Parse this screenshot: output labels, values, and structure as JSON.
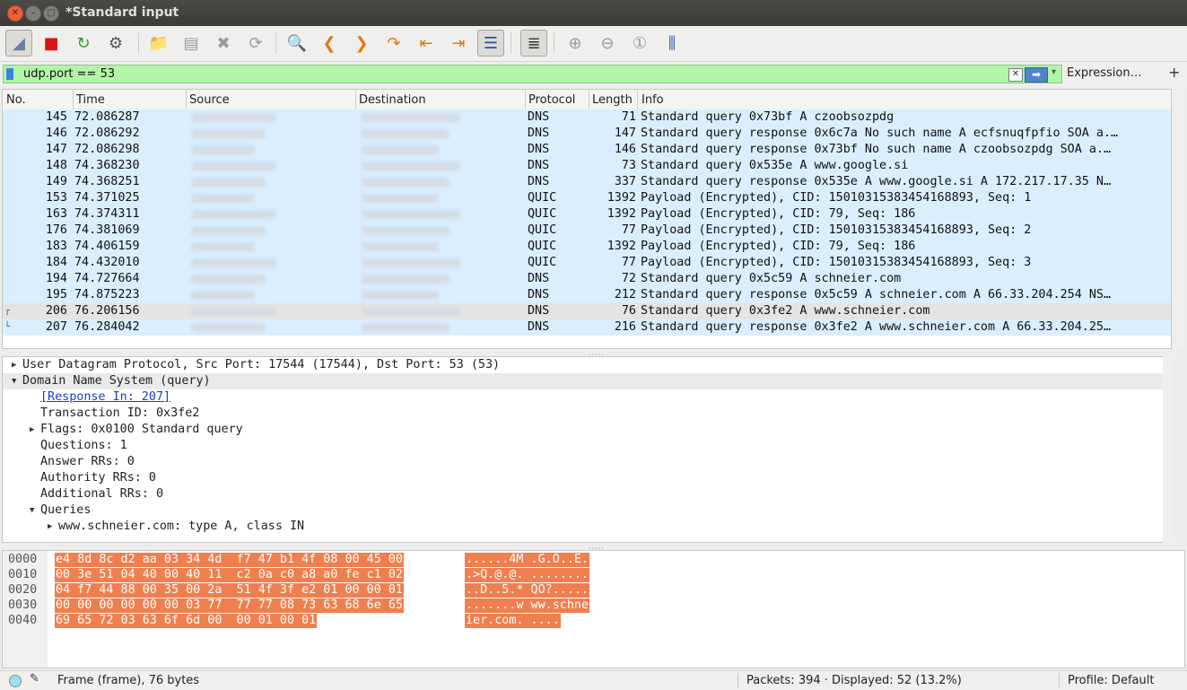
{
  "window": {
    "title": "*Standard input"
  },
  "toolbar": {
    "buttons": [
      {
        "name": "shark-fin-icon",
        "glyph": "◢"
      },
      {
        "name": "stop-capture-icon",
        "glyph": "■"
      },
      {
        "name": "restart-capture-icon",
        "glyph": "↻"
      },
      {
        "name": "capture-options-icon",
        "glyph": "⚙"
      },
      {
        "name": "open-file-icon",
        "glyph": "📁"
      },
      {
        "name": "save-file-icon",
        "glyph": "▤"
      },
      {
        "name": "close-file-icon",
        "glyph": "✖"
      },
      {
        "name": "reload-file-icon",
        "glyph": "⟳"
      },
      {
        "name": "find-packet-icon",
        "glyph": "🔍"
      },
      {
        "name": "go-back-icon",
        "glyph": "❮"
      },
      {
        "name": "go-forward-icon",
        "glyph": "❯"
      },
      {
        "name": "go-to-packet-icon",
        "glyph": "↷"
      },
      {
        "name": "first-packet-icon",
        "glyph": "⇤"
      },
      {
        "name": "last-packet-icon",
        "glyph": "⇥"
      },
      {
        "name": "auto-scroll-icon",
        "glyph": "☰"
      },
      {
        "name": "colorize-icon",
        "glyph": "≣"
      },
      {
        "name": "zoom-in-icon",
        "glyph": "⊕"
      },
      {
        "name": "zoom-out-icon",
        "glyph": "⊖"
      },
      {
        "name": "normal-size-icon",
        "glyph": "①"
      },
      {
        "name": "resize-columns-icon",
        "glyph": "⫼"
      }
    ]
  },
  "filter": {
    "value": "udp.port == 53",
    "clear_glyph": "✕",
    "apply_glyph": "➡",
    "dropdown_glyph": "▾",
    "expression_label": "Expression…",
    "add_glyph": "+"
  },
  "packet_list": {
    "columns": [
      "No.",
      "Time",
      "Source",
      "Destination",
      "Protocol",
      "Length",
      "Info"
    ],
    "rows": [
      {
        "no": "145",
        "time": "72.086287",
        "proto": "DNS",
        "len": "71",
        "info": "Standard query 0x73bf A czoobsozpdg",
        "kind": "dns"
      },
      {
        "no": "146",
        "time": "72.086292",
        "proto": "DNS",
        "len": "147",
        "info": "Standard query response 0x6c7a No such name A ecfsnuqfpfio SOA a.…",
        "kind": "dns"
      },
      {
        "no": "147",
        "time": "72.086298",
        "proto": "DNS",
        "len": "146",
        "info": "Standard query response 0x73bf No such name A czoobsozpdg SOA a.…",
        "kind": "dns"
      },
      {
        "no": "148",
        "time": "74.368230",
        "proto": "DNS",
        "len": "73",
        "info": "Standard query 0x535e A www.google.si",
        "kind": "dns"
      },
      {
        "no": "149",
        "time": "74.368251",
        "proto": "DNS",
        "len": "337",
        "info": "Standard query response 0x535e A www.google.si A 172.217.17.35 N…",
        "kind": "dns"
      },
      {
        "no": "153",
        "time": "74.371025",
        "proto": "QUIC",
        "len": "1392",
        "info": "Payload (Encrypted), CID: 15010315383454168893, Seq: 1",
        "kind": "quic"
      },
      {
        "no": "163",
        "time": "74.374311",
        "proto": "QUIC",
        "len": "1392",
        "info": "Payload (Encrypted), CID: 79, Seq: 186",
        "kind": "quic"
      },
      {
        "no": "176",
        "time": "74.381069",
        "proto": "QUIC",
        "len": "77",
        "info": "Payload (Encrypted), CID: 15010315383454168893, Seq: 2",
        "kind": "quic"
      },
      {
        "no": "183",
        "time": "74.406159",
        "proto": "QUIC",
        "len": "1392",
        "info": "Payload (Encrypted), CID: 79, Seq: 186",
        "kind": "quic"
      },
      {
        "no": "184",
        "time": "74.432010",
        "proto": "QUIC",
        "len": "77",
        "info": "Payload (Encrypted), CID: 15010315383454168893, Seq: 3",
        "kind": "quic"
      },
      {
        "no": "194",
        "time": "74.727664",
        "proto": "DNS",
        "len": "72",
        "info": "Standard query 0x5c59 A schneier.com",
        "kind": "dns"
      },
      {
        "no": "195",
        "time": "74.875223",
        "proto": "DNS",
        "len": "212",
        "info": "Standard query response 0x5c59 A schneier.com A 66.33.204.254 NS…",
        "kind": "dns"
      },
      {
        "no": "206",
        "time": "76.206156",
        "proto": "DNS",
        "len": "76",
        "info": "Standard query 0x3fe2 A www.schneier.com",
        "kind": "sel"
      },
      {
        "no": "207",
        "time": "76.284042",
        "proto": "DNS",
        "len": "216",
        "info": "Standard query response 0x3fe2 A www.schneier.com A 66.33.204.25…",
        "kind": "dns"
      }
    ]
  },
  "details": {
    "rows": [
      {
        "indent": 0,
        "arrow": "▶",
        "text": "User Datagram Protocol, Src Port: 17544 (17544), Dst Port: 53 (53)",
        "hl": false
      },
      {
        "indent": 0,
        "arrow": "▼",
        "text": "Domain Name System (query)",
        "hl": true
      },
      {
        "indent": 1,
        "arrow": "",
        "text": "[Response In: 207]",
        "hl": false,
        "link": true
      },
      {
        "indent": 1,
        "arrow": "",
        "text": "Transaction ID: 0x3fe2",
        "hl": false
      },
      {
        "indent": 1,
        "arrow": "▶",
        "text": "Flags: 0x0100 Standard query",
        "hl": false
      },
      {
        "indent": 1,
        "arrow": "",
        "text": "Questions: 1",
        "hl": false
      },
      {
        "indent": 1,
        "arrow": "",
        "text": "Answer RRs: 0",
        "hl": false
      },
      {
        "indent": 1,
        "arrow": "",
        "text": "Authority RRs: 0",
        "hl": false
      },
      {
        "indent": 1,
        "arrow": "",
        "text": "Additional RRs: 0",
        "hl": false
      },
      {
        "indent": 1,
        "arrow": "▼",
        "text": "Queries",
        "hl": false
      },
      {
        "indent": 2,
        "arrow": "▶",
        "text": "www.schneier.com: type A, class IN",
        "hl": false
      }
    ]
  },
  "bytes": {
    "rows": [
      {
        "off": "0000",
        "hex": "e4 8d 8c d2 aa 03 34 4d  f7 47 b1 4f 08 00 45 00",
        "ascii": "......4M .G.O..E."
      },
      {
        "off": "0010",
        "hex": "00 3e 51 04 40 00 40 11  c2 0a c0 a8 a0 fe c1 02",
        "ascii": ".>Q.@.@. ........"
      },
      {
        "off": "0020",
        "hex": "04 f7 44 88 00 35 00 2a  51 4f 3f e2 01 00 00 01",
        "ascii": "..D..5.* QO?....."
      },
      {
        "off": "0030",
        "hex": "00 00 00 00 00 00 03 77  77 77 08 73 63 68 6e 65",
        "ascii": ".......w ww.schne"
      },
      {
        "off": "0040",
        "hex": "69 65 72 03 63 6f 6d 00  00 01 00 01",
        "ascii": "ier.com. ...."
      }
    ]
  },
  "status": {
    "frame": "Frame (frame), 76 bytes",
    "packets": "Packets: 394 · Displayed: 52 (13.2%)",
    "profile": "Profile: Default"
  }
}
